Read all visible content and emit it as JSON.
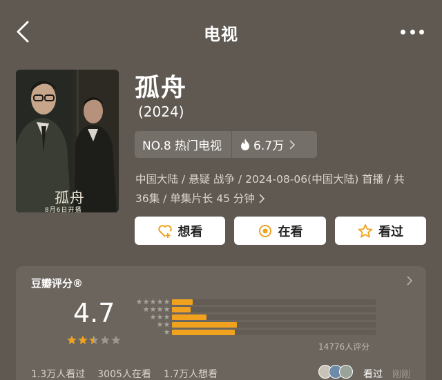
{
  "nav": {
    "title": "电视"
  },
  "poster": {
    "title": "孤舟",
    "date_text": "8月6日开播"
  },
  "show": {
    "title": "孤舟",
    "year": "(2024)",
    "rank": "NO.8 热门电视",
    "heat": "6.7万",
    "meta_line1": "中国大陆 / 悬疑 战争 / 2024-08-06(中国大陆) 首播 / 共",
    "meta_line2": "36集 / 单集片长 45 分钟"
  },
  "actions": {
    "want": "想看",
    "watching": "在看",
    "watched": "看过"
  },
  "rating": {
    "label": "豆瓣评分®",
    "score": "4.7",
    "star_value": 2.5,
    "star_max": 5,
    "distribution": [
      {
        "stars": 5,
        "share": 0.1
      },
      {
        "stars": 4,
        "share": 0.09
      },
      {
        "stars": 3,
        "share": 0.17
      },
      {
        "stars": 2,
        "share": 0.32
      },
      {
        "stars": 1,
        "share": 0.31
      }
    ],
    "votes": "14776人评分",
    "watched_count": "1.3万人看过",
    "watching_count": "3005人在看",
    "want_count": "1.7万人想看",
    "friend_action": "看过",
    "friend_time": "刚刚"
  },
  "colors": {
    "background": "#5f5952",
    "accent": "#f0a21e",
    "card": "#6b655e",
    "rank_box": "#746f68"
  },
  "icons": {
    "back": "chevron-left-icon",
    "more": "more-dots-icon",
    "heat": "flame-icon",
    "want": "heart-plus-icon",
    "watching": "target-icon",
    "watched": "star-icon"
  }
}
